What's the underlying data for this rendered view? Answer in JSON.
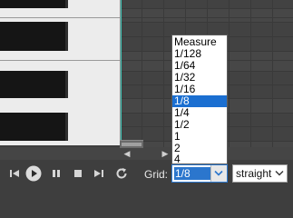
{
  "grid_dropdown": {
    "options": [
      "Measure",
      "1/128",
      "1/64",
      "1/32",
      "1/16",
      "1/8",
      "1/4",
      "1/2",
      "1",
      "2",
      "4"
    ],
    "selected": "1/8"
  },
  "toolbar": {
    "grid_label": "Grid:",
    "grid_value": "1/8",
    "swing_value": "straight",
    "icons": [
      "skip-back-icon",
      "play-icon",
      "pause-icon",
      "stop-icon",
      "skip-forward-icon",
      "loop-icon"
    ]
  },
  "colors": {
    "selection": "#1b6fd1",
    "cursor_line": "#3fc7b8",
    "background": "#3e3e3e"
  }
}
